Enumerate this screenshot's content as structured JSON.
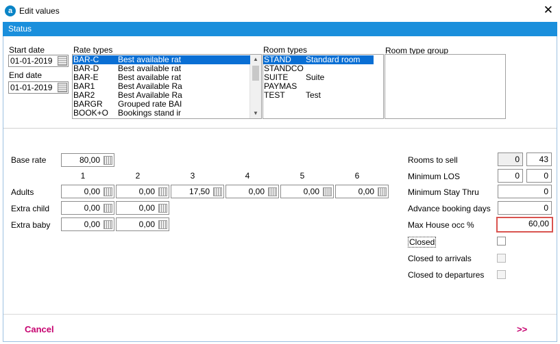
{
  "window": {
    "title": "Edit values",
    "app_icon_letter": "a",
    "close_glyph": "✕"
  },
  "status_bar": {
    "label": "Status"
  },
  "dates": {
    "start_label": "Start date",
    "start_value": "01-01-2019",
    "end_label": "End date",
    "end_value": "01-01-2019"
  },
  "rate_types": {
    "label": "Rate types",
    "items": [
      {
        "code": "BAR-C",
        "name": "Best available rat",
        "selected": true
      },
      {
        "code": "BAR-D",
        "name": "Best available rat",
        "selected": false
      },
      {
        "code": "BAR-E",
        "name": "Best available rat",
        "selected": false
      },
      {
        "code": "BAR1",
        "name": "Best Available Ra",
        "selected": false
      },
      {
        "code": "BAR2",
        "name": "Best Available Ra",
        "selected": false
      },
      {
        "code": "BARGR",
        "name": "Grouped rate BAI",
        "selected": false
      },
      {
        "code": "BOOK+O",
        "name": "Bookings stand ir",
        "selected": false
      }
    ]
  },
  "room_types": {
    "label": "Room types",
    "items": [
      {
        "code": "STAND",
        "name": "Standard room",
        "selected": true
      },
      {
        "code": "STANDCO",
        "name": "",
        "selected": false
      },
      {
        "code": "SUITE",
        "name": "Suite",
        "selected": false
      },
      {
        "code": "PAYMAS",
        "name": "",
        "selected": false
      },
      {
        "code": "TEST",
        "name": "Test",
        "selected": false
      }
    ]
  },
  "room_type_group": {
    "label": "Room type group"
  },
  "rates": {
    "base_rate_label": "Base rate",
    "base_rate": "80,00",
    "columns": [
      "1",
      "2",
      "3",
      "4",
      "5",
      "6"
    ],
    "adults_label": "Adults",
    "adults": [
      "0,00",
      "0,00",
      "17,50",
      "0,00",
      "0,00",
      "0,00"
    ],
    "extra_child_label": "Extra child",
    "extra_child": [
      "0,00",
      "0,00"
    ],
    "extra_baby_label": "Extra baby",
    "extra_baby": [
      "0,00",
      "0,00"
    ]
  },
  "restrictions": {
    "rooms_to_sell_label": "Rooms to sell",
    "rooms_to_sell_a": "0",
    "rooms_to_sell_b": "43",
    "min_los_label": "Minimum LOS",
    "min_los_a": "0",
    "min_los_b": "0",
    "min_stay_thru_label": "Minimum Stay Thru",
    "min_stay_thru": "0",
    "advance_booking_label": "Advance booking days",
    "advance_booking": "0",
    "max_house_occ_label": "Max House occ %",
    "max_house_occ": "60,00",
    "closed_label": "Closed",
    "closed_arrivals_label": "Closed to arrivals",
    "closed_departures_label": "Closed to departures"
  },
  "footer": {
    "cancel_label": "Cancel",
    "next_label": ">>"
  },
  "colors": {
    "status_bar": "#1a8fdc",
    "selection": "#0a6fd4",
    "action": "#c6006f",
    "highlight_border": "#d9534f"
  }
}
